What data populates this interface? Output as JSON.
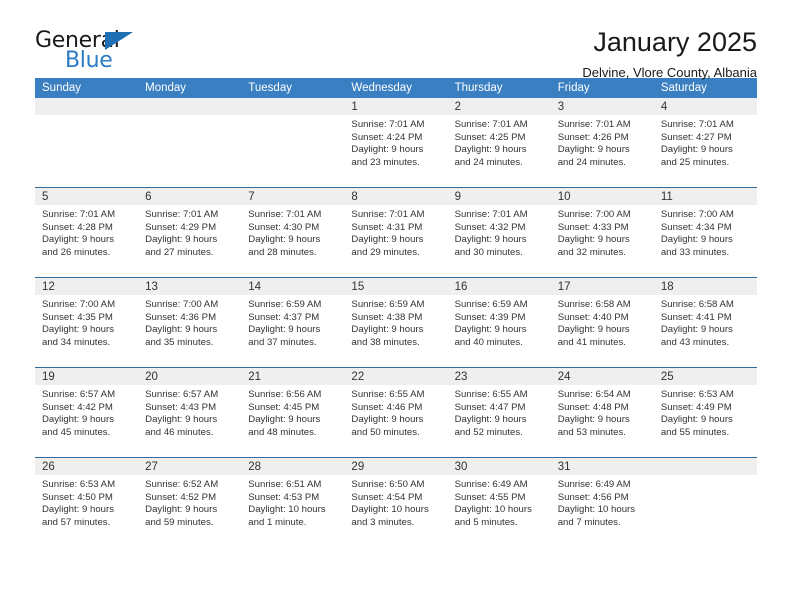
{
  "brand": {
    "name_part1": "General",
    "name_part2": "Blue",
    "logo_icon": "triangle-flag-icon",
    "accent_color": "#2b7cc4"
  },
  "header": {
    "title": "January 2025",
    "subtitle": "Delvine, Vlore County, Albania"
  },
  "colors": {
    "header_row_bg": "#3a7fc1",
    "daynum_band_bg": "#efefef",
    "grid_line": "#2e6da4"
  },
  "weekday_headers": [
    "Sunday",
    "Monday",
    "Tuesday",
    "Wednesday",
    "Thursday",
    "Friday",
    "Saturday"
  ],
  "weeks": [
    [
      {
        "day": "",
        "sunrise": "",
        "sunset": "",
        "daylight_line1": "",
        "daylight_line2": "",
        "empty": true
      },
      {
        "day": "",
        "sunrise": "",
        "sunset": "",
        "daylight_line1": "",
        "daylight_line2": "",
        "empty": true
      },
      {
        "day": "",
        "sunrise": "",
        "sunset": "",
        "daylight_line1": "",
        "daylight_line2": "",
        "empty": true
      },
      {
        "day": "1",
        "sunrise": "Sunrise: 7:01 AM",
        "sunset": "Sunset: 4:24 PM",
        "daylight_line1": "Daylight: 9 hours",
        "daylight_line2": "and 23 minutes.",
        "empty": false
      },
      {
        "day": "2",
        "sunrise": "Sunrise: 7:01 AM",
        "sunset": "Sunset: 4:25 PM",
        "daylight_line1": "Daylight: 9 hours",
        "daylight_line2": "and 24 minutes.",
        "empty": false
      },
      {
        "day": "3",
        "sunrise": "Sunrise: 7:01 AM",
        "sunset": "Sunset: 4:26 PM",
        "daylight_line1": "Daylight: 9 hours",
        "daylight_line2": "and 24 minutes.",
        "empty": false
      },
      {
        "day": "4",
        "sunrise": "Sunrise: 7:01 AM",
        "sunset": "Sunset: 4:27 PM",
        "daylight_line1": "Daylight: 9 hours",
        "daylight_line2": "and 25 minutes.",
        "empty": false
      }
    ],
    [
      {
        "day": "5",
        "sunrise": "Sunrise: 7:01 AM",
        "sunset": "Sunset: 4:28 PM",
        "daylight_line1": "Daylight: 9 hours",
        "daylight_line2": "and 26 minutes.",
        "empty": false
      },
      {
        "day": "6",
        "sunrise": "Sunrise: 7:01 AM",
        "sunset": "Sunset: 4:29 PM",
        "daylight_line1": "Daylight: 9 hours",
        "daylight_line2": "and 27 minutes.",
        "empty": false
      },
      {
        "day": "7",
        "sunrise": "Sunrise: 7:01 AM",
        "sunset": "Sunset: 4:30 PM",
        "daylight_line1": "Daylight: 9 hours",
        "daylight_line2": "and 28 minutes.",
        "empty": false
      },
      {
        "day": "8",
        "sunrise": "Sunrise: 7:01 AM",
        "sunset": "Sunset: 4:31 PM",
        "daylight_line1": "Daylight: 9 hours",
        "daylight_line2": "and 29 minutes.",
        "empty": false
      },
      {
        "day": "9",
        "sunrise": "Sunrise: 7:01 AM",
        "sunset": "Sunset: 4:32 PM",
        "daylight_line1": "Daylight: 9 hours",
        "daylight_line2": "and 30 minutes.",
        "empty": false
      },
      {
        "day": "10",
        "sunrise": "Sunrise: 7:00 AM",
        "sunset": "Sunset: 4:33 PM",
        "daylight_line1": "Daylight: 9 hours",
        "daylight_line2": "and 32 minutes.",
        "empty": false
      },
      {
        "day": "11",
        "sunrise": "Sunrise: 7:00 AM",
        "sunset": "Sunset: 4:34 PM",
        "daylight_line1": "Daylight: 9 hours",
        "daylight_line2": "and 33 minutes.",
        "empty": false
      }
    ],
    [
      {
        "day": "12",
        "sunrise": "Sunrise: 7:00 AM",
        "sunset": "Sunset: 4:35 PM",
        "daylight_line1": "Daylight: 9 hours",
        "daylight_line2": "and 34 minutes.",
        "empty": false
      },
      {
        "day": "13",
        "sunrise": "Sunrise: 7:00 AM",
        "sunset": "Sunset: 4:36 PM",
        "daylight_line1": "Daylight: 9 hours",
        "daylight_line2": "and 35 minutes.",
        "empty": false
      },
      {
        "day": "14",
        "sunrise": "Sunrise: 6:59 AM",
        "sunset": "Sunset: 4:37 PM",
        "daylight_line1": "Daylight: 9 hours",
        "daylight_line2": "and 37 minutes.",
        "empty": false
      },
      {
        "day": "15",
        "sunrise": "Sunrise: 6:59 AM",
        "sunset": "Sunset: 4:38 PM",
        "daylight_line1": "Daylight: 9 hours",
        "daylight_line2": "and 38 minutes.",
        "empty": false
      },
      {
        "day": "16",
        "sunrise": "Sunrise: 6:59 AM",
        "sunset": "Sunset: 4:39 PM",
        "daylight_line1": "Daylight: 9 hours",
        "daylight_line2": "and 40 minutes.",
        "empty": false
      },
      {
        "day": "17",
        "sunrise": "Sunrise: 6:58 AM",
        "sunset": "Sunset: 4:40 PM",
        "daylight_line1": "Daylight: 9 hours",
        "daylight_line2": "and 41 minutes.",
        "empty": false
      },
      {
        "day": "18",
        "sunrise": "Sunrise: 6:58 AM",
        "sunset": "Sunset: 4:41 PM",
        "daylight_line1": "Daylight: 9 hours",
        "daylight_line2": "and 43 minutes.",
        "empty": false
      }
    ],
    [
      {
        "day": "19",
        "sunrise": "Sunrise: 6:57 AM",
        "sunset": "Sunset: 4:42 PM",
        "daylight_line1": "Daylight: 9 hours",
        "daylight_line2": "and 45 minutes.",
        "empty": false
      },
      {
        "day": "20",
        "sunrise": "Sunrise: 6:57 AM",
        "sunset": "Sunset: 4:43 PM",
        "daylight_line1": "Daylight: 9 hours",
        "daylight_line2": "and 46 minutes.",
        "empty": false
      },
      {
        "day": "21",
        "sunrise": "Sunrise: 6:56 AM",
        "sunset": "Sunset: 4:45 PM",
        "daylight_line1": "Daylight: 9 hours",
        "daylight_line2": "and 48 minutes.",
        "empty": false
      },
      {
        "day": "22",
        "sunrise": "Sunrise: 6:55 AM",
        "sunset": "Sunset: 4:46 PM",
        "daylight_line1": "Daylight: 9 hours",
        "daylight_line2": "and 50 minutes.",
        "empty": false
      },
      {
        "day": "23",
        "sunrise": "Sunrise: 6:55 AM",
        "sunset": "Sunset: 4:47 PM",
        "daylight_line1": "Daylight: 9 hours",
        "daylight_line2": "and 52 minutes.",
        "empty": false
      },
      {
        "day": "24",
        "sunrise": "Sunrise: 6:54 AM",
        "sunset": "Sunset: 4:48 PM",
        "daylight_line1": "Daylight: 9 hours",
        "daylight_line2": "and 53 minutes.",
        "empty": false
      },
      {
        "day": "25",
        "sunrise": "Sunrise: 6:53 AM",
        "sunset": "Sunset: 4:49 PM",
        "daylight_line1": "Daylight: 9 hours",
        "daylight_line2": "and 55 minutes.",
        "empty": false
      }
    ],
    [
      {
        "day": "26",
        "sunrise": "Sunrise: 6:53 AM",
        "sunset": "Sunset: 4:50 PM",
        "daylight_line1": "Daylight: 9 hours",
        "daylight_line2": "and 57 minutes.",
        "empty": false
      },
      {
        "day": "27",
        "sunrise": "Sunrise: 6:52 AM",
        "sunset": "Sunset: 4:52 PM",
        "daylight_line1": "Daylight: 9 hours",
        "daylight_line2": "and 59 minutes.",
        "empty": false
      },
      {
        "day": "28",
        "sunrise": "Sunrise: 6:51 AM",
        "sunset": "Sunset: 4:53 PM",
        "daylight_line1": "Daylight: 10 hours",
        "daylight_line2": "and 1 minute.",
        "empty": false
      },
      {
        "day": "29",
        "sunrise": "Sunrise: 6:50 AM",
        "sunset": "Sunset: 4:54 PM",
        "daylight_line1": "Daylight: 10 hours",
        "daylight_line2": "and 3 minutes.",
        "empty": false
      },
      {
        "day": "30",
        "sunrise": "Sunrise: 6:49 AM",
        "sunset": "Sunset: 4:55 PM",
        "daylight_line1": "Daylight: 10 hours",
        "daylight_line2": "and 5 minutes.",
        "empty": false
      },
      {
        "day": "31",
        "sunrise": "Sunrise: 6:49 AM",
        "sunset": "Sunset: 4:56 PM",
        "daylight_line1": "Daylight: 10 hours",
        "daylight_line2": "and 7 minutes.",
        "empty": false
      },
      {
        "day": "",
        "sunrise": "",
        "sunset": "",
        "daylight_line1": "",
        "daylight_line2": "",
        "empty": true
      }
    ]
  ]
}
